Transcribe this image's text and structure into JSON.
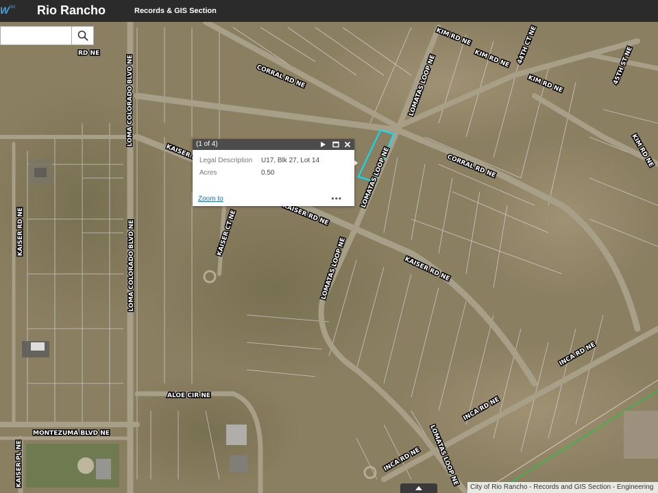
{
  "header": {
    "logo_mark": "W",
    "logo_sm": "SM",
    "app_title": "Rio Rancho",
    "section_title": "Records & GIS Section"
  },
  "search": {
    "placeholder": "",
    "value": "",
    "icon": "search-icon"
  },
  "popup": {
    "title": "(1 of 4)",
    "fields": [
      {
        "label": "Legal Description",
        "value": "U17, Blk 27, Lot 14"
      },
      {
        "label": "Acres",
        "value": "0.50"
      }
    ],
    "zoom_label": "Zoom to",
    "more_label": "•••"
  },
  "map": {
    "road_labels": {
      "kim_rd_1": "KIM RD NE",
      "kim_rd_2": "KIM RD NE",
      "kim_rd_3": "KIM RD NE",
      "kim_rd_4": "KIM RD NE",
      "th44": "44TH CT NE",
      "th45": "45TH ST NE",
      "corral_1": "CORRAL RD NE",
      "corral_2": "CORRAL RD NE",
      "lomatas_1": "LOMATAS LOOP NE",
      "lomatas_2": "LOMATAS LOOP NE",
      "lomatas_3": "LOMATAS LOOP NE",
      "lomatas_4": "LOMATAS LOOP NE",
      "kaiser_rd_1": "KAISER RD NE",
      "kaiser_rd_2": "KAISER RD NE",
      "kaiser_rd_3": "KAISER RD NE",
      "kaiser_ct": "KAISER CT NE",
      "kaiser_pl": "KAISER PL NE",
      "loma_colorado": "LOMA COLORADO BLVD NE",
      "aloe": "ALOE CIR NE",
      "montezuma": "MONTEZUMA BLVD NE",
      "inca_1": "INCA RD NE",
      "inca_2": "INCA RD NE",
      "inca_3": "INCA RD NE",
      "partial_rd": "RD NE"
    },
    "colors": {
      "selected_parcel": "#00e5ff",
      "terrain": "#8a7d60",
      "road": "#a49b85",
      "parcel_line": "#e8e8f0"
    }
  },
  "attribution": "City of Rio Rancho - Records and GIS Section - Engineering"
}
